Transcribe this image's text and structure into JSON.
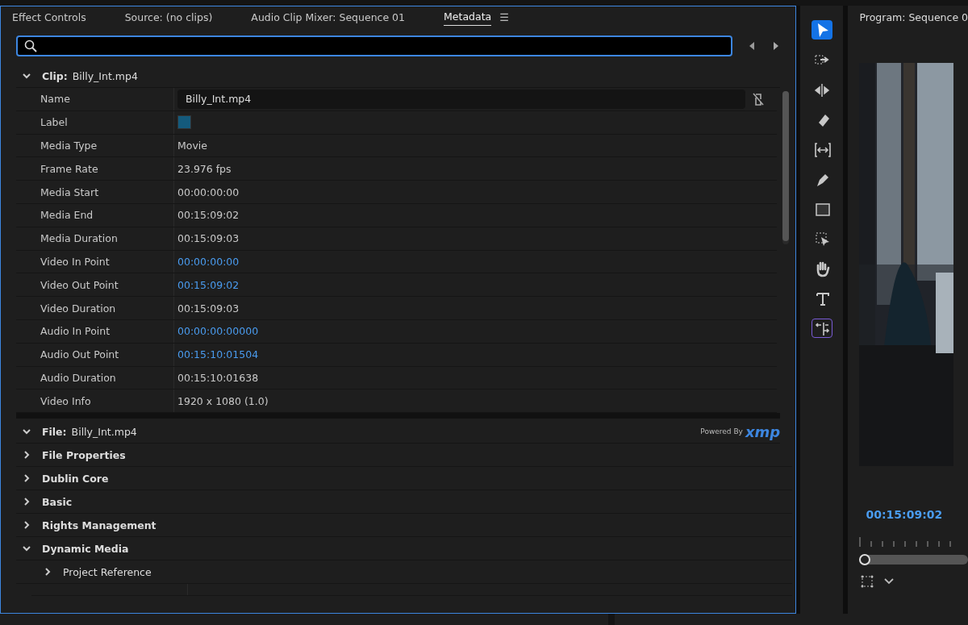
{
  "tabs": [
    {
      "label": "Effect Controls",
      "selected": false
    },
    {
      "label": "Source: (no clips)",
      "selected": false
    },
    {
      "label": "Audio Clip Mixer: Sequence 01",
      "selected": false
    },
    {
      "label": "Metadata",
      "selected": true
    }
  ],
  "menu_icon": "☰",
  "clip_section": {
    "label": "Clip:",
    "name": "Billy_Int.mp4",
    "expanded": true,
    "rows": [
      {
        "label": "Name",
        "kind": "field",
        "value": "Billy_Int.mp4"
      },
      {
        "label": "Label",
        "kind": "swatch",
        "color": "#145a7c"
      },
      {
        "label": "Media Type",
        "kind": "text",
        "value": "Movie"
      },
      {
        "label": "Frame Rate",
        "kind": "text",
        "value": "23.976 fps"
      },
      {
        "label": "Media Start",
        "kind": "text",
        "value": "00:00:00:00"
      },
      {
        "label": "Media End",
        "kind": "text",
        "value": "00:15:09:02"
      },
      {
        "label": "Media Duration",
        "kind": "text",
        "value": "00:15:09:03"
      },
      {
        "label": "Video In Point",
        "kind": "link",
        "value": "00:00:00:00"
      },
      {
        "label": "Video Out Point",
        "kind": "link",
        "value": "00:15:09:02"
      },
      {
        "label": "Video Duration",
        "kind": "text",
        "value": "00:15:09:03"
      },
      {
        "label": "Audio In Point",
        "kind": "link",
        "value": "00:00:00:00000"
      },
      {
        "label": "Audio Out Point",
        "kind": "link",
        "value": "00:15:10:01504"
      },
      {
        "label": "Audio Duration",
        "kind": "text",
        "value": "00:15:10:01638"
      },
      {
        "label": "Video Info",
        "kind": "text",
        "value": "1920 x 1080 (1.0)"
      }
    ]
  },
  "file_section": {
    "label": "File:",
    "name": "Billy_Int.mp4",
    "expanded": true,
    "powered_by": "Powered By",
    "logo": "xmp",
    "groups": [
      {
        "label": "File Properties",
        "expanded": false
      },
      {
        "label": "Dublin Core",
        "expanded": false
      },
      {
        "label": "Basic",
        "expanded": false
      },
      {
        "label": "Rights Management",
        "expanded": false
      },
      {
        "label": "Dynamic Media",
        "expanded": true,
        "children": [
          {
            "label": "Project Reference",
            "expanded": false
          }
        ]
      }
    ]
  },
  "tools": [
    {
      "kind": "select",
      "selected": true
    },
    {
      "kind": "track",
      "selected": false
    },
    {
      "kind": "ripple",
      "selected": false
    },
    {
      "kind": "razor",
      "selected": false
    },
    {
      "kind": "slip",
      "selected": false
    },
    {
      "kind": "pen",
      "selected": false
    },
    {
      "kind": "rect",
      "selected": false
    },
    {
      "kind": "frame",
      "selected": false
    },
    {
      "kind": "hand",
      "selected": false
    },
    {
      "kind": "type",
      "selected": false
    },
    {
      "kind": "remix",
      "selected": false
    }
  ],
  "program": {
    "title": "Program: Sequence 0",
    "timecode": "00:15:09:02",
    "level": 0
  }
}
